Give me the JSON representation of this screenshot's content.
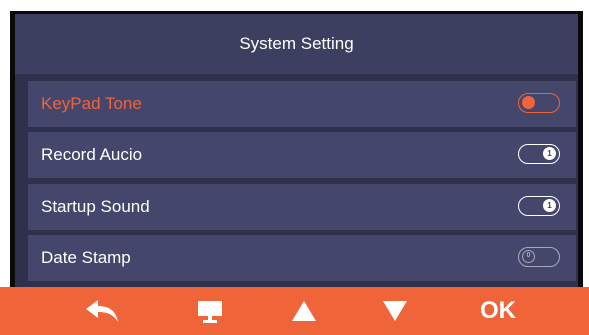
{
  "header": {
    "title": "System Setting"
  },
  "settings": {
    "items": [
      {
        "label": "KeyPad Tone",
        "selected": true,
        "toggle": "on"
      },
      {
        "label": "Record Aucio",
        "selected": false,
        "toggle": "on",
        "knob_text": "1"
      },
      {
        "label": "Startup Sound",
        "selected": false,
        "toggle": "on",
        "knob_text": "1"
      },
      {
        "label": "Date Stamp",
        "selected": false,
        "toggle": "off",
        "knob_text": "0"
      }
    ]
  },
  "footer": {
    "buttons": [
      {
        "icon": "back-arrow-icon"
      },
      {
        "icon": "monitor-icon"
      },
      {
        "icon": "triangle-up-icon"
      },
      {
        "icon": "triangle-down-icon"
      },
      {
        "label": "OK"
      }
    ]
  },
  "colors": {
    "accent": "#f0643a",
    "header_bg": "#3d3f61",
    "row_bg": "#44476b",
    "list_bg": "#2e304c"
  }
}
